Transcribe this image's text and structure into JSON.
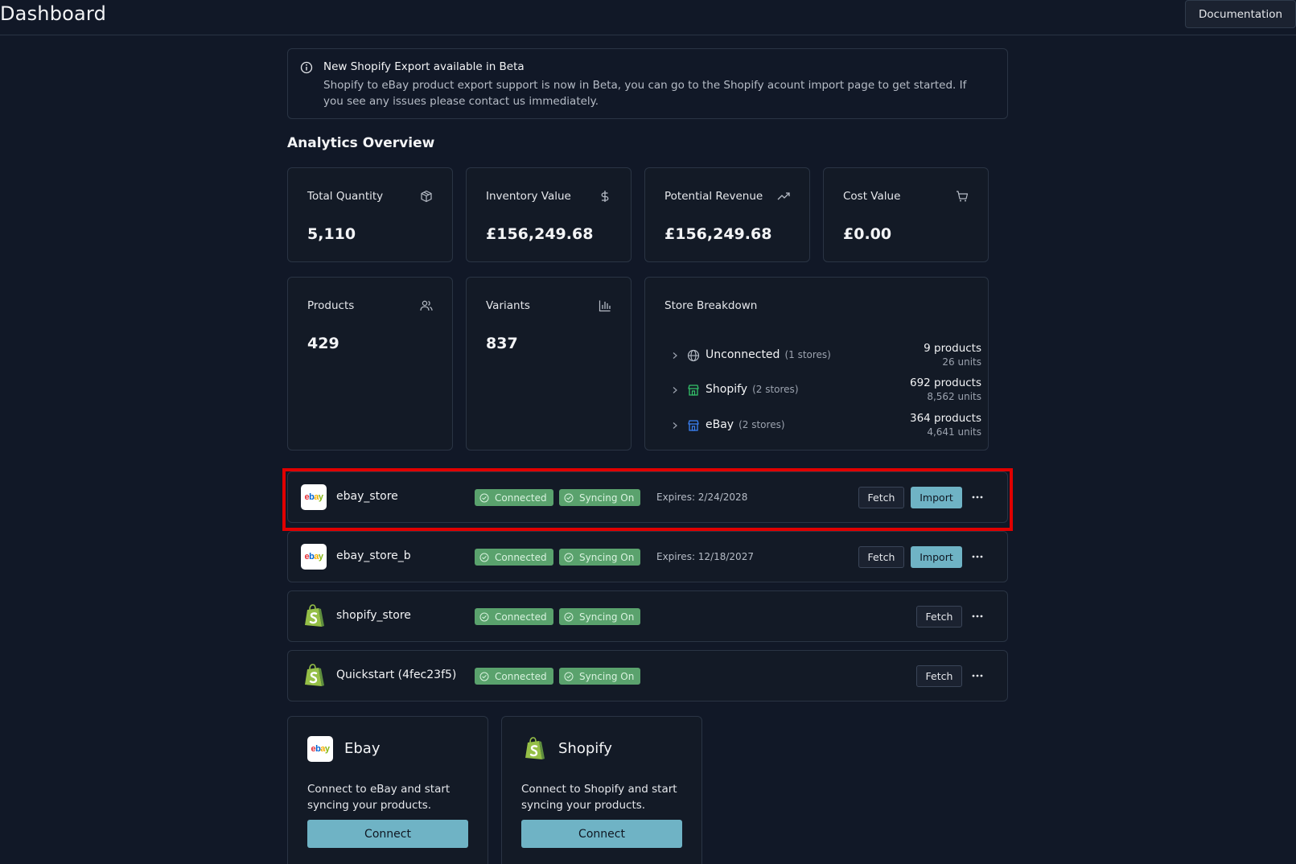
{
  "header": {
    "title": "Dashboard",
    "documentation_label": "Documentation"
  },
  "alert": {
    "title": "New Shopify Export available in Beta",
    "body": "Shopify to eBay product export support is now in Beta, you can go to the Shopify acount import page to get started. If you see any issues please contact us immediately."
  },
  "analytics": {
    "title": "Analytics Overview",
    "cards": [
      {
        "label": "Total Quantity",
        "value": "5,110",
        "icon": "box-icon"
      },
      {
        "label": "Inventory Value",
        "value": "£156,249.68",
        "icon": "dollar-icon"
      },
      {
        "label": "Potential Revenue",
        "value": "£156,249.68",
        "icon": "trending-up-icon"
      },
      {
        "label": "Cost Value",
        "value": "£0.00",
        "icon": "cart-icon"
      },
      {
        "label": "Products",
        "value": "429",
        "icon": "users-icon"
      },
      {
        "label": "Variants",
        "value": "837",
        "icon": "bar-chart-icon"
      }
    ],
    "store_breakdown": {
      "title": "Store Breakdown",
      "rows": [
        {
          "name": "Unconnected",
          "count": "(1 stores)",
          "products": "9 products",
          "units": "26 units",
          "icon": "globe-icon"
        },
        {
          "name": "Shopify",
          "count": "(2 stores)",
          "products": "692 products",
          "units": "8,562 units",
          "icon": "store-icon"
        },
        {
          "name": "eBay",
          "count": "(2 stores)",
          "products": "364 products",
          "units": "4,641 units",
          "icon": "store-icon"
        }
      ]
    }
  },
  "stores": [
    {
      "name": "ebay_store",
      "type": "ebay",
      "connected": "Connected",
      "syncing": "Syncing On",
      "expires": "Expires: 2/24/2028",
      "fetch": "Fetch",
      "import": "Import"
    },
    {
      "name": "ebay_store_b",
      "type": "ebay",
      "connected": "Connected",
      "syncing": "Syncing On",
      "expires": "Expires: 12/18/2027",
      "fetch": "Fetch",
      "import": "Import"
    },
    {
      "name": "shopify_store",
      "type": "shopify",
      "connected": "Connected",
      "syncing": "Syncing On",
      "fetch": "Fetch"
    },
    {
      "name": "Quickstart (4fec23f5)",
      "type": "shopify",
      "connected": "Connected",
      "syncing": "Syncing On",
      "fetch": "Fetch"
    }
  ],
  "connectors": [
    {
      "title": "Ebay",
      "description": "Connect to eBay and start syncing your products.",
      "button": "Connect"
    },
    {
      "title": "Shopify",
      "description": "Connect to Shopify and start syncing your products.",
      "button": "Connect"
    }
  ],
  "ebay_logo_text": {
    "e": "e",
    "b": "b",
    "a": "a",
    "y": "y"
  },
  "colors": {
    "background": "#111827",
    "badge_green": "#5aa26d",
    "accent_teal": "#6fb3c5",
    "highlight_red": "#e00000"
  }
}
